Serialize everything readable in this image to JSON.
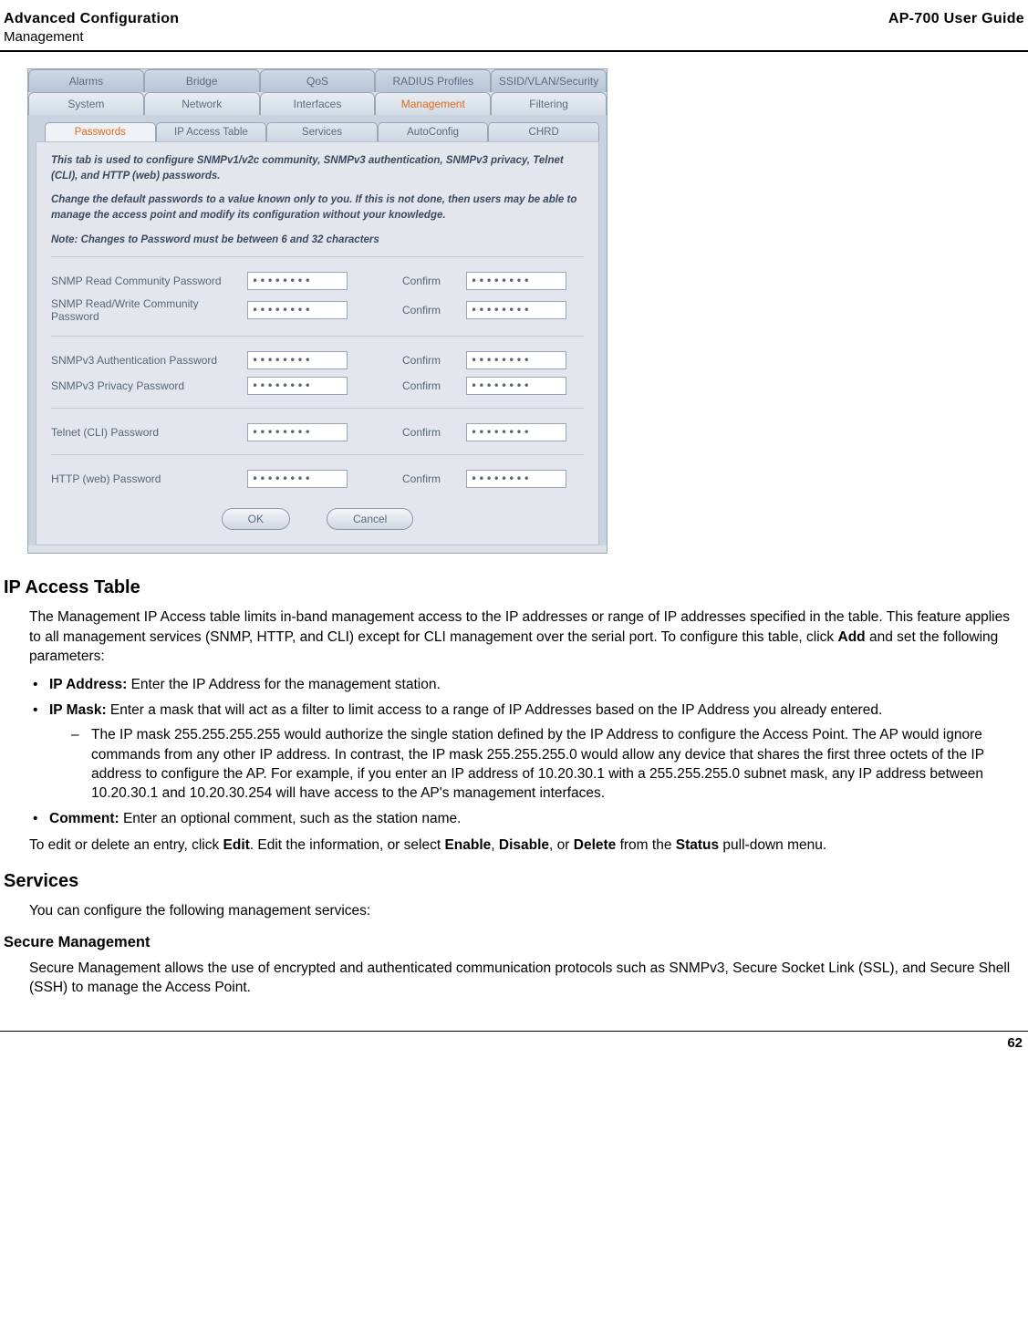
{
  "header": {
    "title_bold": "Advanced Configuration",
    "subtitle": "Management",
    "right": "AP-700 User Guide"
  },
  "screenshot": {
    "tabs_row1": [
      "Alarms",
      "Bridge",
      "QoS",
      "RADIUS Profiles",
      "SSID/VLAN/Security"
    ],
    "tabs_row2": [
      "System",
      "Network",
      "Interfaces",
      "Management",
      "Filtering"
    ],
    "tabs_row2_active_index": 3,
    "sub_tabs": [
      "Passwords",
      "IP Access Table",
      "Services",
      "AutoConfig",
      "CHRD"
    ],
    "sub_tabs_active_index": 0,
    "desc1": "This tab is used to configure SNMPv1/v2c community, SNMPv3 authentication, SNMPv3 privacy, Telnet (CLI), and HTTP (web) passwords.",
    "desc2": "Change the default passwords to a value known only to you. If this is not done, then users may be able to manage the access point and modify its configuration without your knowledge.",
    "desc3": "Note: Changes to Password must be between 6 and 32 characters",
    "confirm_label": "Confirm",
    "pw_mask": "••••••••",
    "groups": [
      {
        "fields": [
          {
            "label": "SNMP Read Community Password"
          },
          {
            "label": "SNMP Read/Write Community Password"
          }
        ]
      },
      {
        "fields": [
          {
            "label": "SNMPv3 Authentication Password"
          },
          {
            "label": "SNMPv3 Privacy Password"
          }
        ]
      },
      {
        "fields": [
          {
            "label": "Telnet (CLI) Password"
          }
        ]
      },
      {
        "fields": [
          {
            "label": "HTTP (web) Password"
          }
        ]
      }
    ],
    "buttons": {
      "ok": "OK",
      "cancel": "Cancel"
    }
  },
  "sections": {
    "ip_access": {
      "heading": "IP Access Table",
      "para_pre": "The Management IP Access table limits in-band management access to the IP addresses or range of IP addresses specified in the table. This feature applies to all management services (SNMP, HTTP, and CLI) except for CLI management over the serial port. To configure this table, click ",
      "para_bold": "Add",
      "para_post": " and set the following parameters:",
      "bullets": {
        "ip_addr_bold": "IP Address:",
        "ip_addr_text": " Enter the IP Address for the management station.",
        "ip_mask_bold": "IP Mask:",
        "ip_mask_text": " Enter a mask that will act as a filter to limit access to a range of IP Addresses based on the IP Address you already entered.",
        "ip_mask_dash": "The IP mask 255.255.255.255 would authorize the single station defined by the IP Address to configure the Access Point. The AP would ignore commands from any other IP address. In contrast, the IP mask 255.255.255.0 would allow any device that shares the first three octets of the IP address to configure the AP. For example, if you enter an IP address of 10.20.30.1 with a 255.255.255.0 subnet mask, any IP address between 10.20.30.1 and 10.20.30.254 will have access to the AP's management interfaces.",
        "comment_bold": "Comment:",
        "comment_text": " Enter an optional comment, such as the station name."
      },
      "edit_pre": "To edit or delete an entry, click ",
      "edit_b1": "Edit",
      "edit_mid1": ". Edit the information, or select ",
      "edit_b2": "Enable",
      "edit_mid2": ", ",
      "edit_b3": "Disable",
      "edit_mid3": ", or ",
      "edit_b4": "Delete",
      "edit_mid4": " from the ",
      "edit_b5": "Status",
      "edit_post": " pull-down menu."
    },
    "services": {
      "heading": "Services",
      "para": "You can configure the following management services:"
    },
    "secure_mgmt": {
      "heading": "Secure Management",
      "para": "Secure Management allows the use of encrypted and authenticated communication protocols such as SNMPv3, Secure Socket Link (SSL), and Secure Shell (SSH) to manage the Access Point."
    }
  },
  "footer": {
    "page": "62"
  }
}
